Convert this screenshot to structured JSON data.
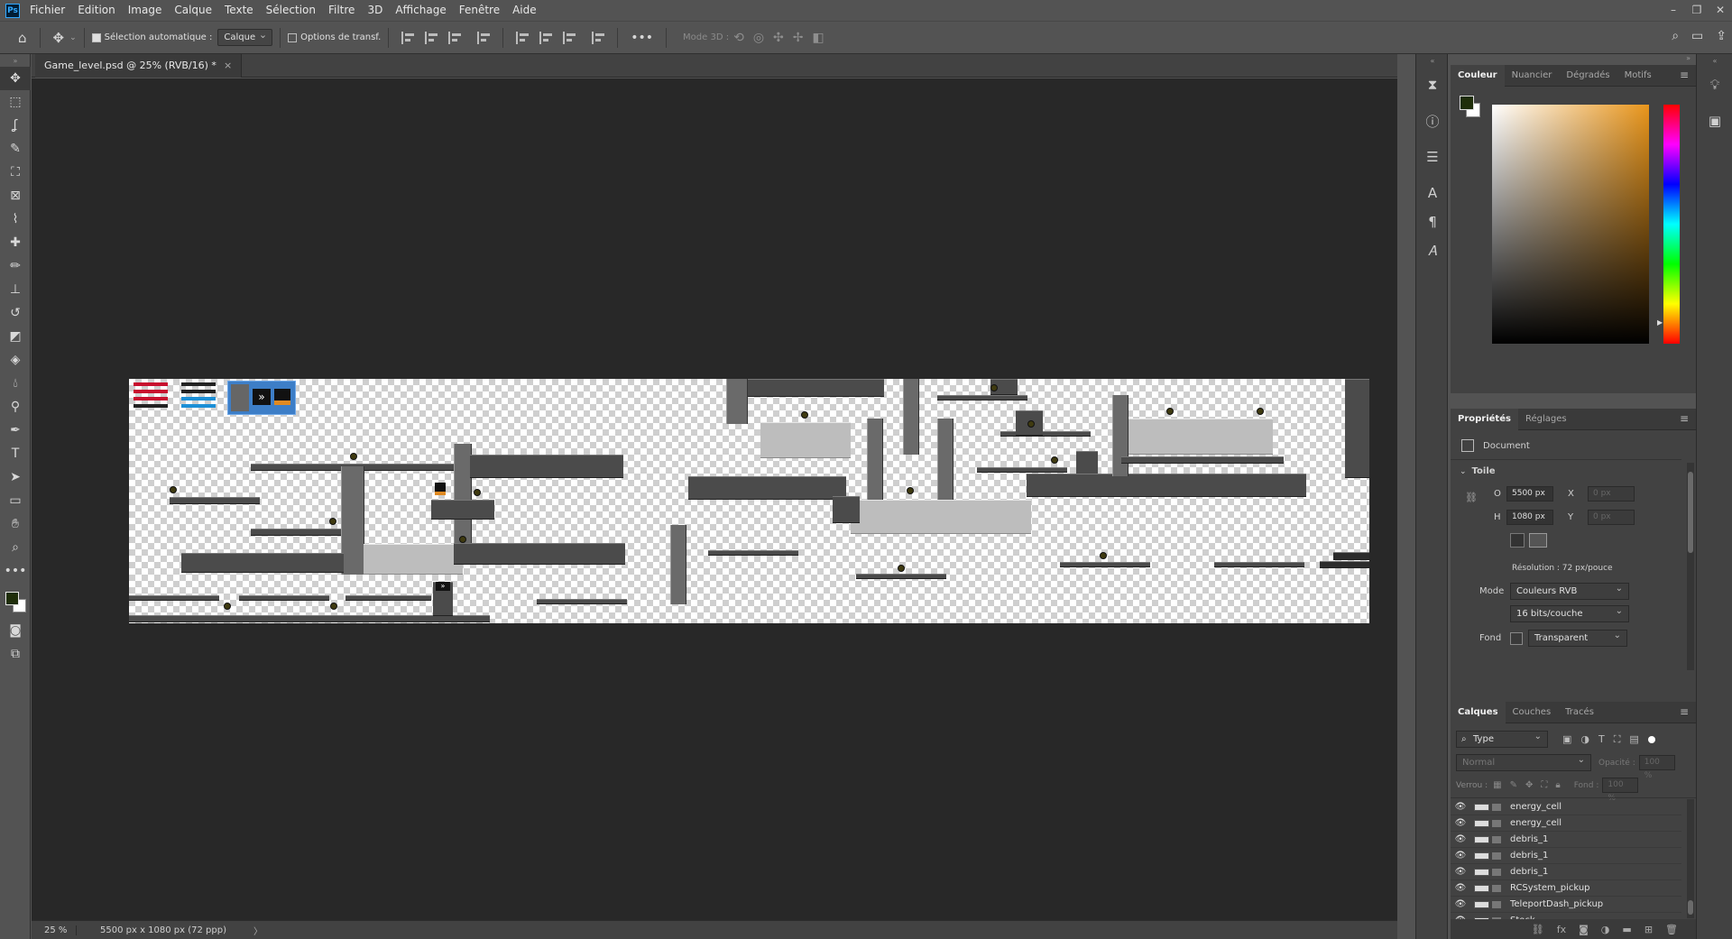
{
  "menubar": {
    "items": [
      "Fichier",
      "Edition",
      "Image",
      "Calque",
      "Texte",
      "Sélection",
      "Filtre",
      "3D",
      "Affichage",
      "Fenêtre",
      "Aide"
    ],
    "logo": "Ps",
    "controls": [
      "minimize-icon",
      "restore-icon",
      "close-icon"
    ]
  },
  "options": {
    "auto_select_label": "Sélection automatique :",
    "auto_select_value": "Calque",
    "transform_label": "Options de transf.",
    "mode3d_label": "Mode 3D :"
  },
  "document": {
    "tab_title": "Game_level.psd @ 25% (RVB/16) *",
    "close_glyph": "×",
    "zoom": "25 %",
    "size_info": "5500 px x 1080 px (72 ppp)",
    "status_arrow": "〉"
  },
  "color_panel": {
    "tabs": [
      "Couleur",
      "Nuancier",
      "Dégradés",
      "Motifs"
    ],
    "foreground": "#1f2e0a",
    "background": "#ffffff",
    "accent_hue": "#e8951b"
  },
  "properties": {
    "tabs": [
      "Propriétés",
      "Réglages"
    ],
    "doc_label": "Document",
    "section": "Toile",
    "w_label": "O",
    "w_value": "5500 px",
    "h_label": "H",
    "h_value": "1080 px",
    "x_label": "X",
    "x_value": "0 px",
    "y_label": "Y",
    "y_value": "0 px",
    "resolution": "Résolution : 72 px/pouce",
    "mode_label": "Mode",
    "mode_value": "Couleurs RVB",
    "depth_value": "16 bits/couche",
    "fond_label": "Fond",
    "fond_value": "Transparent"
  },
  "layers": {
    "tabs": [
      "Calques",
      "Couches",
      "Tracés"
    ],
    "filter_value": "Type",
    "blend_mode": "Normal",
    "opacity_label": "Opacité :",
    "opacity_value": "100 %",
    "lock_label": "Verrou :",
    "fill_label": "Fond :",
    "fill_value": "100 %",
    "items": [
      "energy_cell",
      "energy_cell",
      "debris_1",
      "debris_1",
      "debris_1",
      "RCSystem_pickup",
      "TeleportDash_pickup",
      "Stock"
    ]
  }
}
